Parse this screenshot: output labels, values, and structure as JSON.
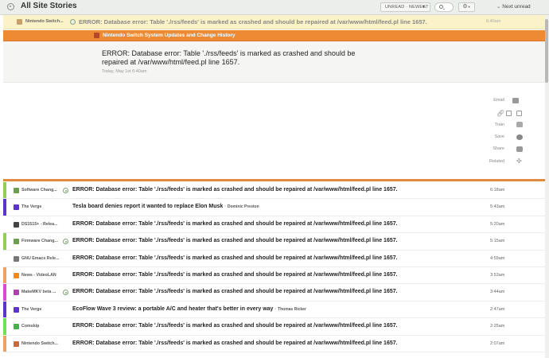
{
  "header": {
    "title": "All Site Stories",
    "order_label": "UNREAD · NEWEST",
    "next_label": "Next unread",
    "icons": {
      "feed": "rss-icon",
      "search": "search-icon",
      "settings": "gear-icon",
      "next": "chevron-down-icon"
    }
  },
  "selected_story": {
    "feed": "Nintendo Switch...",
    "title": "ERROR: Database error: Table './rss/feeds' is marked as crashed and should be repaired at /var/www/html/feed.pl line 1657.",
    "time": "6:40am"
  },
  "feed_bar": {
    "name": "Nintendo Switch System Updates and Change History"
  },
  "detail": {
    "title": "ERROR: Database error: Table './rss/feeds' is marked as crashed and should be repaired at /var/www/html/feed.pl line 1657.",
    "date": "Today, May 1st 6:40am"
  },
  "actions": {
    "email": "Email",
    "train": "Train",
    "save": "Save",
    "share": "Share",
    "related": "Related"
  },
  "stories": [
    {
      "feed": "Software Chang...",
      "title": "ERROR: Database error: Table './rss/feeds' is marked as crashed and should be repaired at /var/www/html/feed.pl line 1657.",
      "author": "",
      "time": "6:18am",
      "color": "#8ecf5b",
      "icon_color": "#6aa14a",
      "dot": true
    },
    {
      "feed": "The Verge",
      "title": "Tesla board denies report it wanted to replace Elon Musk",
      "author": "Dominic Preston",
      "time": "5:43am",
      "color": "#5a35c8",
      "icon_color": "#5a35c8",
      "dot": false
    },
    {
      "feed": "DS1515+ - Relea...",
      "title": "ERROR: Database error: Table './rss/feeds' is marked as crashed and should be repaired at /var/www/html/feed.pl line 1657.",
      "author": "",
      "time": "5:20am",
      "color": "#ffffff",
      "icon_color": "#444444",
      "dot": false
    },
    {
      "feed": "Firmware Chang...",
      "title": "ERROR: Database error: Table './rss/feeds' is marked as crashed and should be repaired at /var/www/html/feed.pl line 1657.",
      "author": "",
      "time": "5:15am",
      "color": "#8ecf5b",
      "icon_color": "#6aa14a",
      "dot": true
    },
    {
      "feed": "GNU Emacs Rele...",
      "title": "ERROR: Database error: Table './rss/feeds' is marked as crashed and should be repaired at /var/www/html/feed.pl line 1657.",
      "author": "",
      "time": "4:59am",
      "color": "#ffffff",
      "icon_color": "#777777",
      "dot": false
    },
    {
      "feed": "News - VideoLAN",
      "title": "ERROR: Database error: Table './rss/feeds' is marked as crashed and should be repaired at /var/www/html/feed.pl line 1657.",
      "author": "",
      "time": "3:53am",
      "color": "#e8a36a",
      "icon_color": "#f08a1c",
      "dot": false
    },
    {
      "feed": "MakeMKV beta ...",
      "title": "ERROR: Database error: Table './rss/feeds' is marked as crashed and should be repaired at /var/www/html/feed.pl line 1657.",
      "author": "",
      "time": "3:44am",
      "color": "#d84bd1",
      "icon_color": "#b03fb0",
      "dot": true
    },
    {
      "feed": "The Verge",
      "title": "EcoFlow Wave 3 review: a portable A/C and heater that's better in every way",
      "author": "Thomas Ricker",
      "time": "2:47am",
      "color": "#5a35c8",
      "icon_color": "#5a35c8",
      "dot": false
    },
    {
      "feed": "Comskip",
      "title": "ERROR: Database error: Table './rss/feeds' is marked as crashed and should be repaired at /var/www/html/feed.pl line 1657.",
      "author": "",
      "time": "2:25am",
      "color": "#6ee05a",
      "icon_color": "#48b04a",
      "dot": false
    },
    {
      "feed": "Nintendo Switch...",
      "title": "ERROR: Database error: Table './rss/feeds' is marked as crashed and should be repaired at /var/www/html/feed.pl line 1657.",
      "author": "",
      "time": "2:07am",
      "color": "#e8a36a",
      "icon_color": "#c86a3a",
      "dot": false
    }
  ]
}
